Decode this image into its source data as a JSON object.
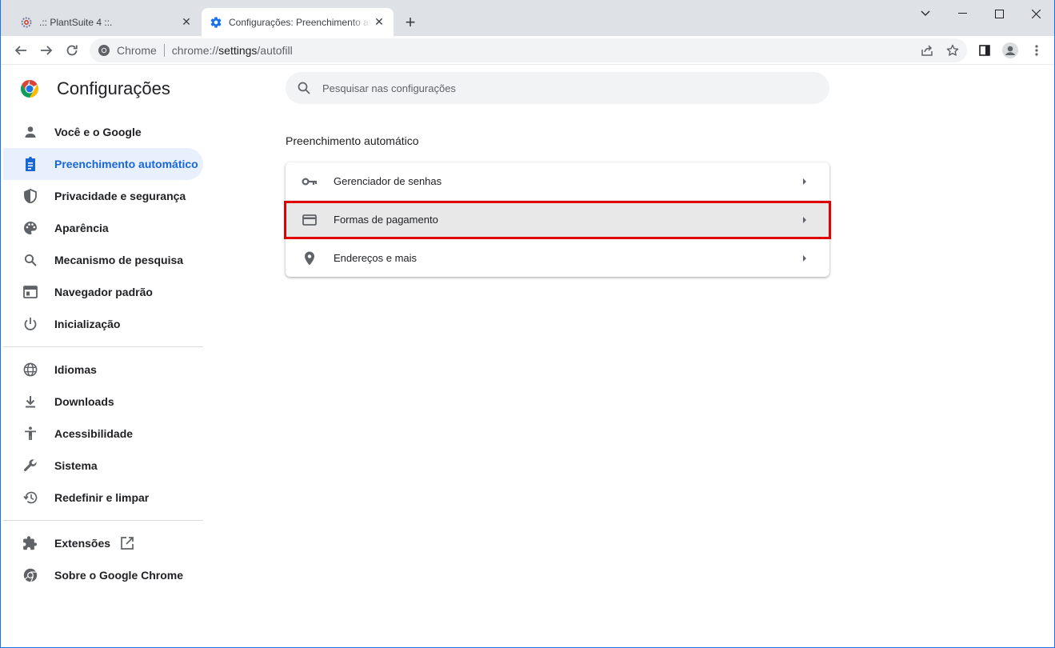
{
  "tabs": [
    {
      "title": ".:: PlantSuite 4 ::.",
      "active": false,
      "favicon": "plantsuite-gear-icon"
    },
    {
      "title": "Configurações: Preenchimento automático",
      "active": true,
      "favicon": "settings-gear-icon"
    }
  ],
  "toolbar": {
    "site_chip": "Chrome",
    "url_scheme": "chrome://",
    "url_host": "settings",
    "url_path": "/autofill"
  },
  "settings": {
    "title": "Configurações",
    "search_placeholder": "Pesquisar nas configurações",
    "nav": [
      {
        "label": "Você e o Google",
        "icon": "person-icon"
      },
      {
        "label": "Preenchimento automático",
        "icon": "clipboard-icon",
        "selected": true
      },
      {
        "label": "Privacidade e segurança",
        "icon": "shield-icon"
      },
      {
        "label": "Aparência",
        "icon": "palette-icon"
      },
      {
        "label": "Mecanismo de pesquisa",
        "icon": "search-icon"
      },
      {
        "label": "Navegador padrão",
        "icon": "browser-icon"
      },
      {
        "label": "Inicialização",
        "icon": "power-icon"
      },
      {
        "label": "Idiomas",
        "icon": "globe-icon"
      },
      {
        "label": "Downloads",
        "icon": "download-icon"
      },
      {
        "label": "Acessibilidade",
        "icon": "accessibility-icon"
      },
      {
        "label": "Sistema",
        "icon": "wrench-icon"
      },
      {
        "label": "Redefinir e limpar",
        "icon": "restore-icon"
      },
      {
        "label": "Extensões",
        "icon": "puzzle-icon"
      },
      {
        "label": "Sobre o Google Chrome",
        "icon": "chrome-icon"
      }
    ],
    "section_title": "Preenchimento automático",
    "rows": [
      {
        "label": "Gerenciador de senhas",
        "icon": "key-icon"
      },
      {
        "label": "Formas de pagamento",
        "icon": "credit-card-icon",
        "highlighted": true
      },
      {
        "label": "Endereços e mais",
        "icon": "location-pin-icon"
      }
    ]
  },
  "colors": {
    "accent": "#1a73e8",
    "selected_nav_bg": "#e8f0fe",
    "selected_nav_text": "#1967d2",
    "highlight_border": "#e00000"
  }
}
